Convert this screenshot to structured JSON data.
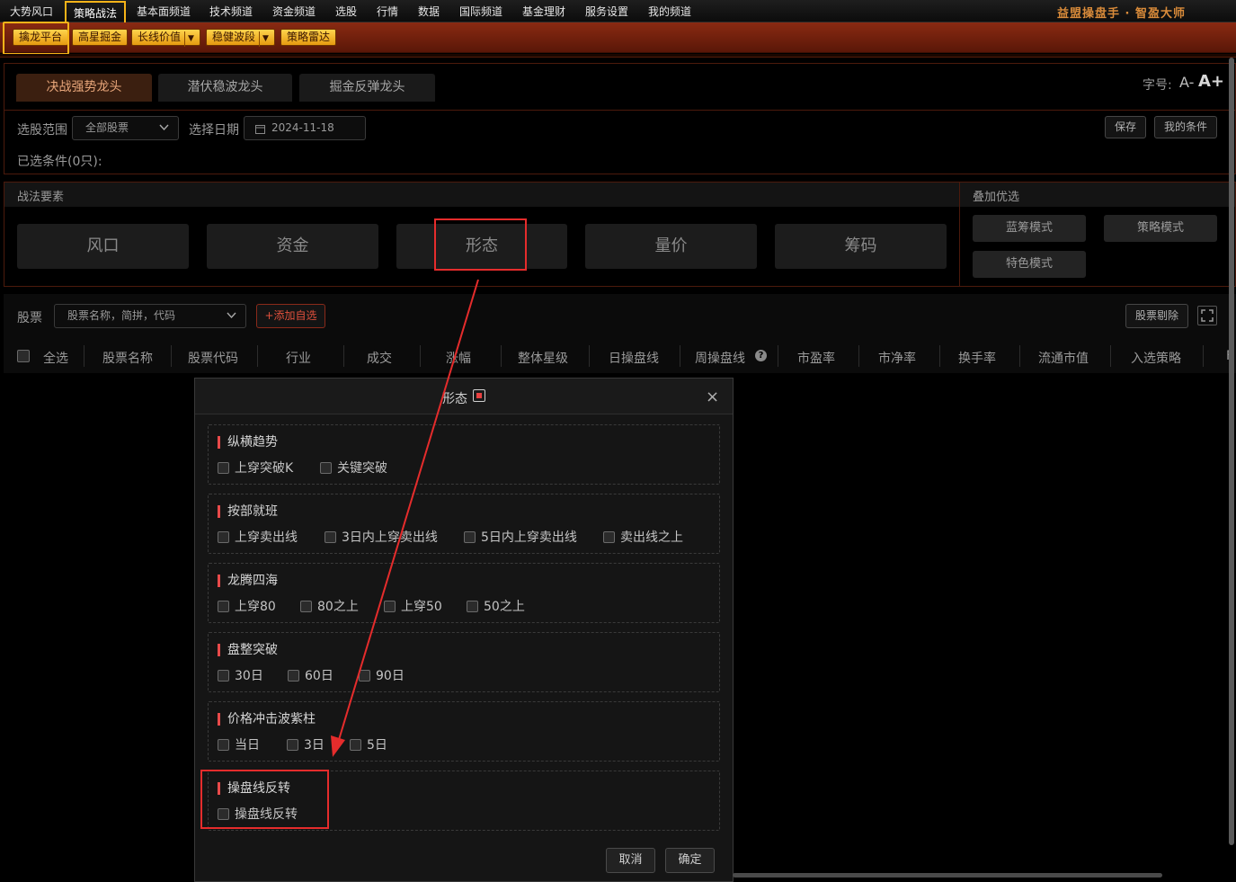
{
  "top_menu": {
    "items": [
      "大势风口",
      "策略战法",
      "基本面频道",
      "技术频道",
      "资金频道",
      "选股",
      "行情",
      "数据",
      "国际频道",
      "基金理财",
      "服务设置",
      "我的频道"
    ],
    "brand": "益盟操盘手 · 智盈大师"
  },
  "sub_bar": {
    "items": [
      "擒龙平台",
      "高星掘金",
      "长线价值",
      "稳健波段",
      "策略雷达"
    ],
    "dropdown_glyph": "▼"
  },
  "strategy_tabs": [
    "决战强势龙头",
    "潜伏稳波龙头",
    "掘金反弹龙头"
  ],
  "font_size": {
    "label": "字号:",
    "decrease": "A-",
    "increase": "A+"
  },
  "filter": {
    "range_label": "选股范围",
    "range_value": "全部股票",
    "date_label": "选择日期",
    "date_value": "2024-11-18",
    "save": "保存",
    "my_conditions": "我的条件",
    "selected": "已选条件(0只):"
  },
  "elements": {
    "title": "战法要素",
    "cards": [
      "风口",
      "资金",
      "形态",
      "量价",
      "筹码"
    ]
  },
  "overlay": {
    "title": "叠加优选",
    "modes": [
      "蓝筹模式",
      "策略模式",
      "特色模式"
    ]
  },
  "stock_bar": {
    "label": "股票",
    "search_placeholder": "股票名称，简拼，代码",
    "add": "+添加自选",
    "remove": "股票剔除"
  },
  "table": {
    "headers": [
      "全选",
      "股票名称",
      "股票代码",
      "行业",
      "成交",
      "涨幅",
      "整体星级",
      "日操盘线",
      "周操盘线",
      "市盈率",
      "市净率",
      "换手率",
      "流通市值",
      "入选策略",
      "F"
    ],
    "help_glyph": "?"
  },
  "modal": {
    "title": "形态",
    "close": "×",
    "sections": [
      {
        "title": "纵横趋势",
        "options": [
          "上穿突破K",
          "关键突破"
        ]
      },
      {
        "title": "按部就班",
        "options": [
          "上穿卖出线",
          "3日内上穿卖出线",
          "5日内上穿卖出线",
          "卖出线之上"
        ]
      },
      {
        "title": "龙腾四海",
        "options": [
          "上穿80",
          "80之上",
          "上穿50",
          "50之上"
        ]
      },
      {
        "title": "盘整突破",
        "options": [
          "30日",
          "60日",
          "90日"
        ]
      },
      {
        "title": "价格冲击波紫柱",
        "options": [
          "当日",
          "3日",
          "5日"
        ]
      },
      {
        "title": "操盘线反转",
        "options": [
          "操盘线反转"
        ]
      }
    ],
    "cancel": "取消",
    "confirm": "确定"
  }
}
